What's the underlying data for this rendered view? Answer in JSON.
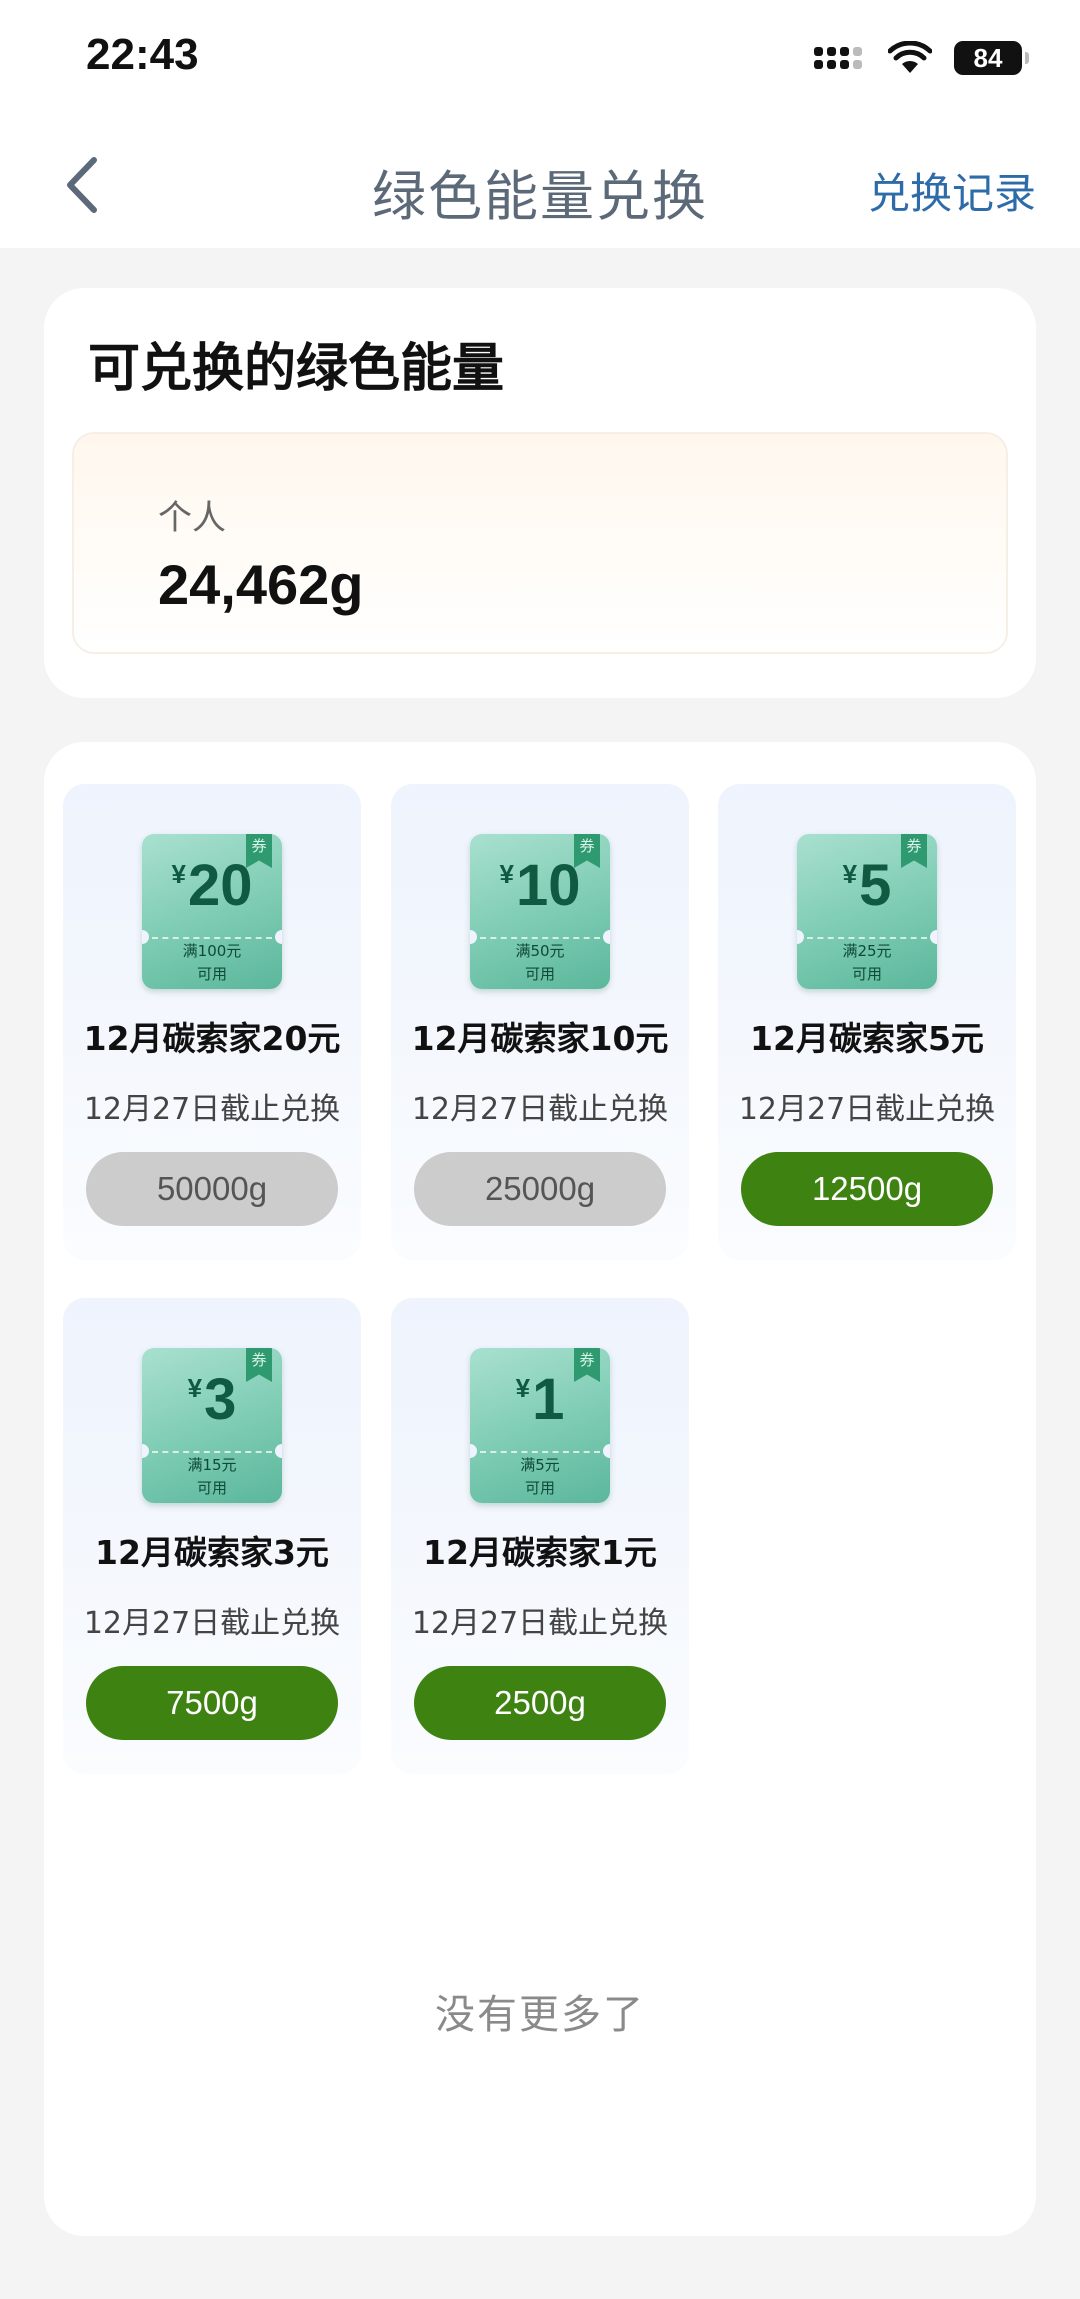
{
  "status_bar": {
    "time": "22:43",
    "battery": "84"
  },
  "nav": {
    "title": "绿色能量兑换",
    "action": "兑换记录"
  },
  "energy": {
    "title": "可兑换的绿色能量",
    "label": "个人",
    "value": "24,462g"
  },
  "coupons": [
    {
      "yen": "¥",
      "amount": "20",
      "badge": "券",
      "condition": "满100元",
      "usable": "可用",
      "name": "12月碳索家20元",
      "deadline": "12月27日截止兑换",
      "price": "50000g",
      "state": "disabled"
    },
    {
      "yen": "¥",
      "amount": "10",
      "badge": "券",
      "condition": "满50元",
      "usable": "可用",
      "name": "12月碳索家10元",
      "deadline": "12月27日截止兑换",
      "price": "25000g",
      "state": "disabled"
    },
    {
      "yen": "¥",
      "amount": "5",
      "badge": "券",
      "condition": "满25元",
      "usable": "可用",
      "name": "12月碳索家5元",
      "deadline": "12月27日截止兑换",
      "price": "12500g",
      "state": "active"
    },
    {
      "yen": "¥",
      "amount": "3",
      "badge": "券",
      "condition": "满15元",
      "usable": "可用",
      "name": "12月碳索家3元",
      "deadline": "12月27日截止兑换",
      "price": "7500g",
      "state": "active"
    },
    {
      "yen": "¥",
      "amount": "1",
      "badge": "券",
      "condition": "满5元",
      "usable": "可用",
      "name": "12月碳索家1元",
      "deadline": "12月27日截止兑换",
      "price": "2500g",
      "state": "active"
    }
  ],
  "footer": {
    "no_more": "没有更多了"
  },
  "colors": {
    "active_button": "#3e8211",
    "disabled_button": "#cccccc",
    "accent_link": "#2d6ca8",
    "ticket_green": "#7ccbb2"
  },
  "icons": {
    "back": "chevron-left-icon",
    "wifi": "wifi-icon",
    "signal": "signal-icon",
    "battery": "battery-icon"
  }
}
